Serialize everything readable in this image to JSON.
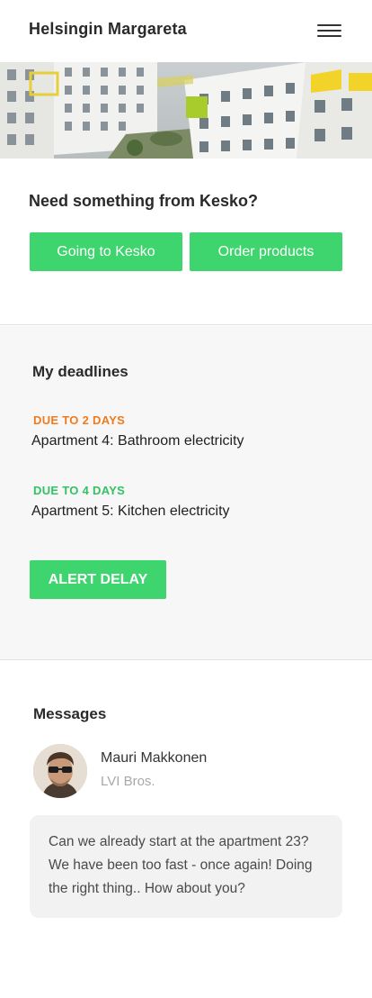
{
  "header": {
    "title": "Helsingin Margareta",
    "menu_icon": "hamburger-menu-icon"
  },
  "hero": {
    "image": "apartment-buildings-photo"
  },
  "kesko": {
    "heading": "Need something from Kesko?",
    "going_label": "Going to Kesko",
    "order_label": "Order products",
    "button_color": "#3ed46e"
  },
  "deadlines": {
    "heading": "My deadlines",
    "items": [
      {
        "due": "DUE TO 2 DAYS",
        "due_color": "#f07b1d",
        "task": "Apartment 4: Bathroom electricity"
      },
      {
        "due": "DUE TO 4 DAYS",
        "due_color": "#33c163",
        "task": "Apartment 5: Kitchen electricity"
      }
    ],
    "alert_label": "ALERT DELAY"
  },
  "messages": {
    "heading": "Messages",
    "sender": {
      "name": "Mauri Makkonen",
      "company": "LVI Bros."
    },
    "text": "Can we already start at the apartment 23? We have been too fast - once again! Doing the right thing.. How about you?"
  }
}
